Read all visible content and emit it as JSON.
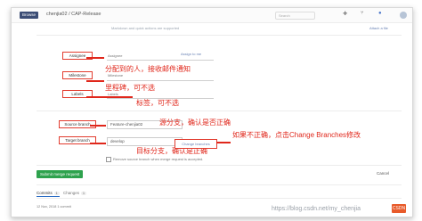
{
  "header": {
    "badge": "Browse",
    "breadcrumb": "chenjia02 / CAP-Release",
    "search_placeholder": "Search",
    "icons": [
      "plus-icon",
      "merge-icon",
      "bell-icon",
      "avatar"
    ]
  },
  "editor": {
    "markdown_hint": "Markdown and quick actions are supported",
    "attach_label": "Attach a file"
  },
  "fields": {
    "assignee": {
      "label": "Assignee",
      "value": "Assignee",
      "link": "Assign to me"
    },
    "milestone": {
      "label": "Milestone",
      "value": "Milestone"
    },
    "labels": {
      "label": "Labels",
      "value": "Labels"
    },
    "source_branch": {
      "label": "Source branch",
      "value": "Feature-chenjia02"
    },
    "target_branch": {
      "label": "Target branch",
      "value": "develop"
    },
    "change_branches": "Change branches",
    "remove_source": "Remove source branch when merge request is accepted."
  },
  "annotations": {
    "assignee": "分配到的人，接收邮件通知",
    "milestone": "里程碑，可不选",
    "labels": "标签，可不选",
    "source": "源分支，确认是否正确",
    "target": "目标分支，确认是正确",
    "change": "如果不正确，点击Change Branches修改"
  },
  "actions": {
    "submit": "Submit merge request",
    "cancel": "Cancel"
  },
  "tabs": {
    "commits": "Commits",
    "commits_count": "1",
    "changes": "Changes",
    "changes_count": "1"
  },
  "footer": {
    "timestamp": "12 Nov, 2018 1 commit",
    "watermark": "https://blog.csdn.net/my_chenjia",
    "csdn_logo": "CSDN"
  }
}
